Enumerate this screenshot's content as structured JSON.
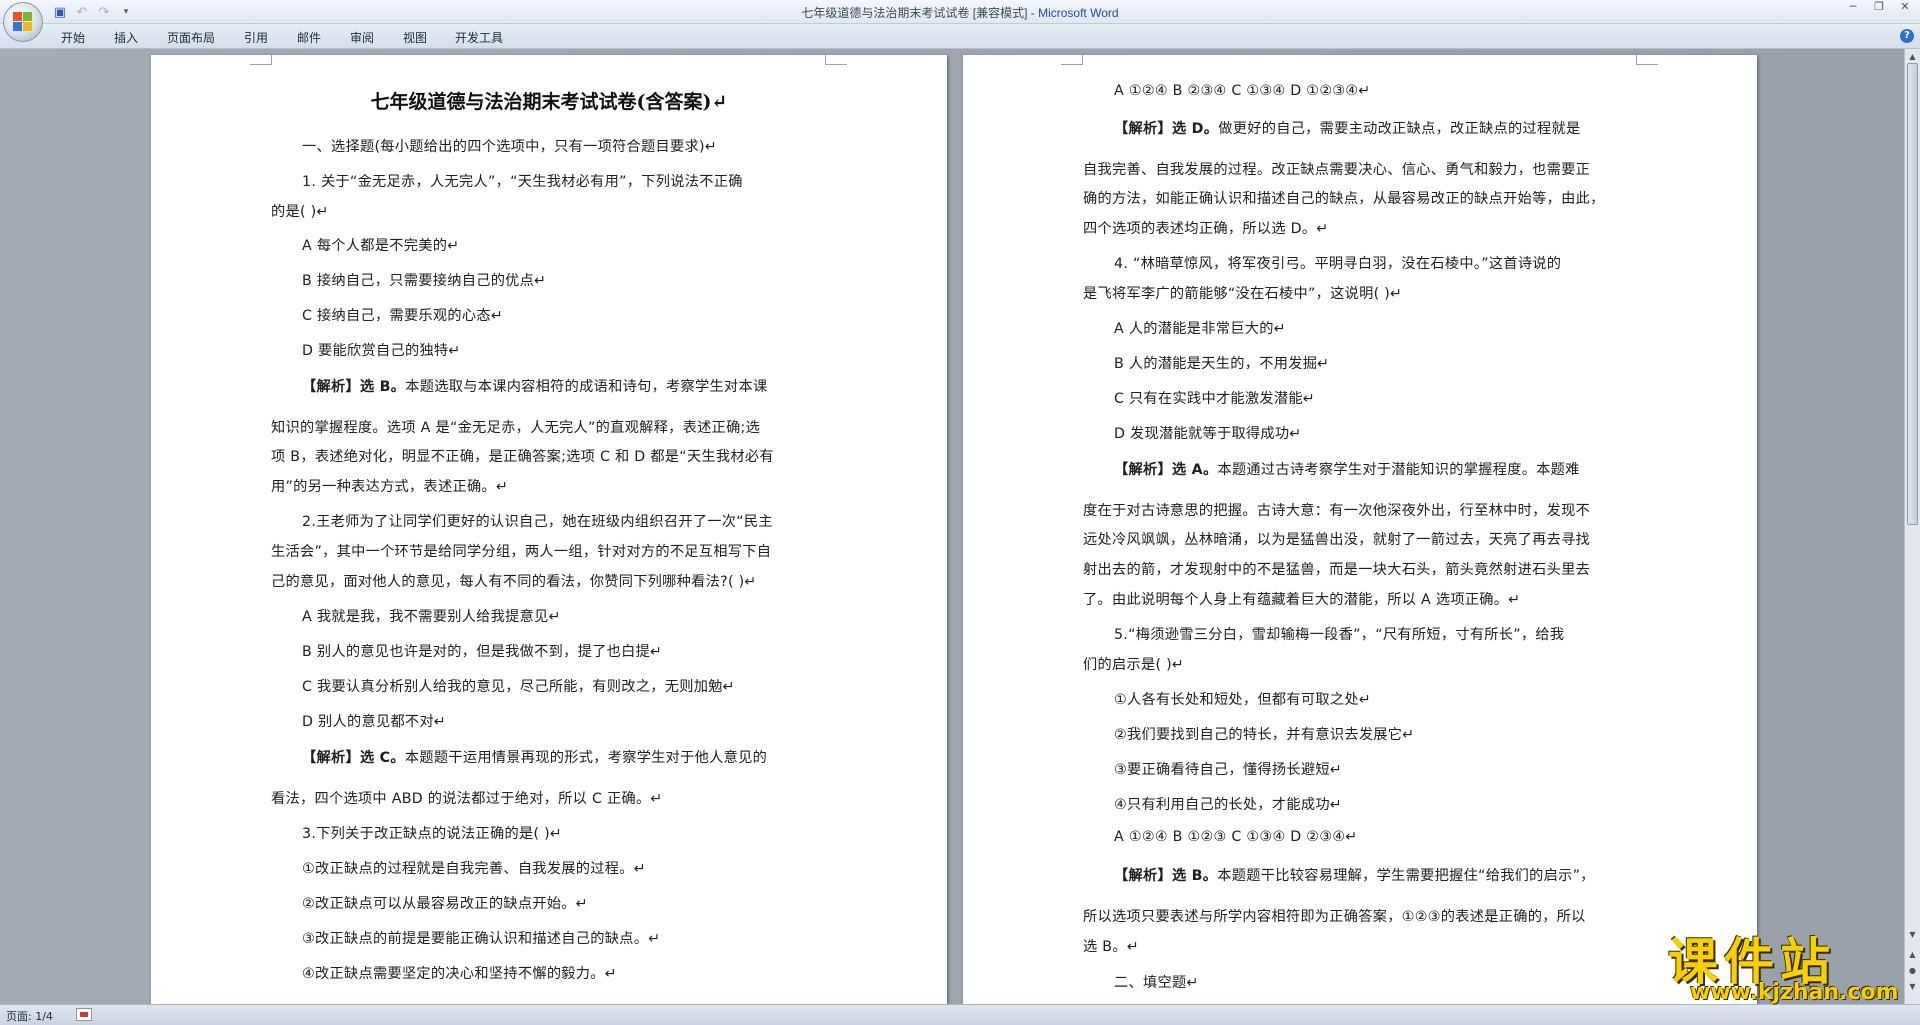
{
  "window": {
    "title": "七年级道德与法治期末考试试卷 [兼容模式] - ",
    "app_name": "Microsoft Word"
  },
  "quick_access": {
    "save_icon": "save-icon",
    "undo_icon": "undo-icon",
    "redo_icon": "redo-icon",
    "customize_icon": "chevron-down-icon"
  },
  "ribbon_tabs": [
    "开始",
    "插入",
    "页面布局",
    "引用",
    "邮件",
    "审阅",
    "视图",
    "开发工具"
  ],
  "status": {
    "page_indicator": "页面: 1/4"
  },
  "watermark": {
    "text": "课件站",
    "url": "www.kjzhan.com"
  },
  "document": {
    "title": "七年级道德与法治期末考试试卷(含答案)↵",
    "left_lines": [
      "一、选择题(每小题给出的四个选项中，只有一项符合题目要求)↵",
      "1. 关于“金无足赤，人无完人”，“天生我材必有用”，下列说法不正确",
      "的是( )↵",
      "A 每个人都是不完美的↵",
      "B 接纳自己，只需要接纳自己的优点↵",
      "C 接纳自己，需要乐观的心态↵",
      "D 要能欣赏自己的独特↵",
      "知识的掌握程度。选项 A 是“金无足赤，人无完人”的直观解释，表述正确;选",
      "项 B，表述绝对化，明显不正确，是正确答案;选项 C 和 D 都是“天生我材必有",
      "用”的另一种表达方式，表述正确。↵",
      "2.王老师为了让同学们更好的认识自己，她在班级内组织召开了一次“民主",
      "生活会”，其中一个环节是给同学分组，两人一组，针对对方的不足互相写下自",
      "己的意见，面对他人的意见，每人有不同的看法，你赞同下列哪种看法?( )↵",
      "A 我就是我，我不需要别人给我提意见↵",
      "B 别人的意见也许是对的，但是我做不到，提了也白提↵",
      "C 我要认真分析别人给我的意见，尽己所能，有则改之，无则加勉↵",
      "D 别人的意见都不对↵",
      "看法，四个选项中 ABD 的说法都过于绝对，所以 C 正确。↵",
      "3.下列关于改正缺点的说法正确的是( )↵",
      "①改正缺点的过程就是自我完善、自我发展的过程。↵",
      "②改正缺点可以从最容易改正的缺点开始。↵",
      "③改正缺点的前提是要能正确认识和描述自己的缺点。↵",
      "④改正缺点需要坚定的决心和坚持不懈的毅力。↵"
    ],
    "left_analysis": [
      {
        "tag": "【解析】选 B。",
        "text": "本题选取与本课内容相符的成语和诗句，考察学生对本课"
      },
      {
        "tag": "【解析】选 C。",
        "text": "本题题干运用情景再现的形式，考察学生对于他人意见的"
      }
    ],
    "right_lines": [
      "A ①②④ B ②③④ C ①③④ D ①②③④↵",
      "自我完善、自我发展的过程。改正缺点需要决心、信心、勇气和毅力，也需要正",
      "确的方法，如能正确认识和描述自己的缺点，从最容易改正的缺点开始等，由此，",
      "四个选项的表述均正确，所以选 D。↵",
      "4. “林暗草惊风，将军夜引弓。平明寻白羽，没在石棱中。”这首诗说的",
      "是飞将军李广的箭能够“没在石棱中”，这说明( )↵",
      "A 人的潜能是非常巨大的↵",
      "B 人的潜能是天生的，不用发掘↵",
      "C 只有在实践中才能激发潜能↵",
      "D 发现潜能就等于取得成功↵",
      "度在于对古诗意思的把握。古诗大意：有一次他深夜外出，行至林中时，发现不",
      "远处冷风飒飒，丛林暗涌，以为是猛兽出没，就射了一箭过去，天亮了再去寻找",
      "射出去的箭，才发现射中的不是猛兽，而是一块大石头，箭头竟然射进石头里去",
      "了。由此说明每个人身上有蕴藏着巨大的潜能，所以 A 选项正确。↵",
      "5.“梅须逊雪三分白，雪却输梅一段香”，“尺有所短，寸有所长”，给我",
      "们的启示是( )↵",
      "①人各有长处和短处，但都有可取之处↵",
      "②我们要找到自己的特长，并有意识去发展它↵",
      "③要正确看待自己，懂得扬长避短↵",
      "④只有利用自己的长处，才能成功↵",
      "A ①②④ B ①②③ C ①③④ D ②③④↵",
      "所以选项只要表述与所学内容相符即为正确答案，①②③的表述是正确的，所以",
      "选 B。↵",
      "二、填空题↵"
    ],
    "right_analysis": [
      {
        "tag": "【解析】选 D。",
        "text": "做更好的自己，需要主动改正缺点，改正缺点的过程就是"
      },
      {
        "tag": "【解析】选 A。",
        "text": "本题通过古诗考察学生对于潜能知识的掌握程度。本题难"
      },
      {
        "tag": "【解析】选 B。",
        "text": "本题题干比较容易理解，学生需要把握住“给我们的启示”，"
      }
    ]
  }
}
